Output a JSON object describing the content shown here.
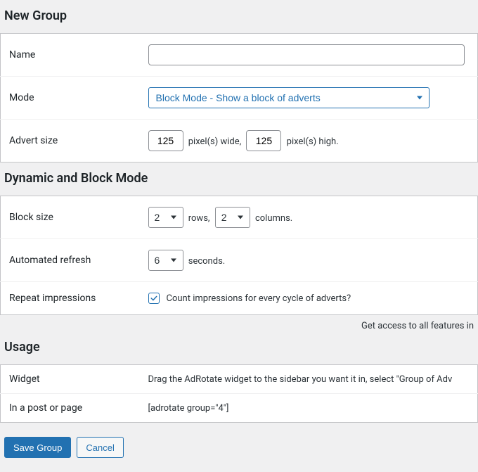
{
  "sections": {
    "newGroup": "New Group",
    "dynamicBlock": "Dynamic and Block Mode",
    "usage": "Usage"
  },
  "labels": {
    "name": "Name",
    "mode": "Mode",
    "advertSize": "Advert size",
    "blockSize": "Block size",
    "automatedRefresh": "Automated refresh",
    "repeatImpressions": "Repeat impressions",
    "widget": "Widget",
    "inPostOrPage": "In a post or page"
  },
  "fields": {
    "nameValue": "",
    "modeSelected": "Block Mode - Show a block of adverts",
    "advertWidth": "125",
    "advertHeight": "125",
    "blockRows": "2",
    "blockCols": "2",
    "refreshSeconds": "6",
    "repeatImpressionsChecked": true
  },
  "text": {
    "pixelsWide": "pixel(s) wide,",
    "pixelsHigh": "pixel(s) high.",
    "rows": "rows,",
    "columns": "columns.",
    "seconds": "seconds.",
    "countImpressions": "Count impressions for every cycle of adverts?",
    "accessNote": "Get access to all features in",
    "widgetInstruction": "Drag the AdRotate widget to the sidebar you want it in, select \"Group of Adv",
    "shortcode": "[adrotate group=\"4\"]"
  },
  "buttons": {
    "save": "Save Group",
    "cancel": "Cancel"
  }
}
